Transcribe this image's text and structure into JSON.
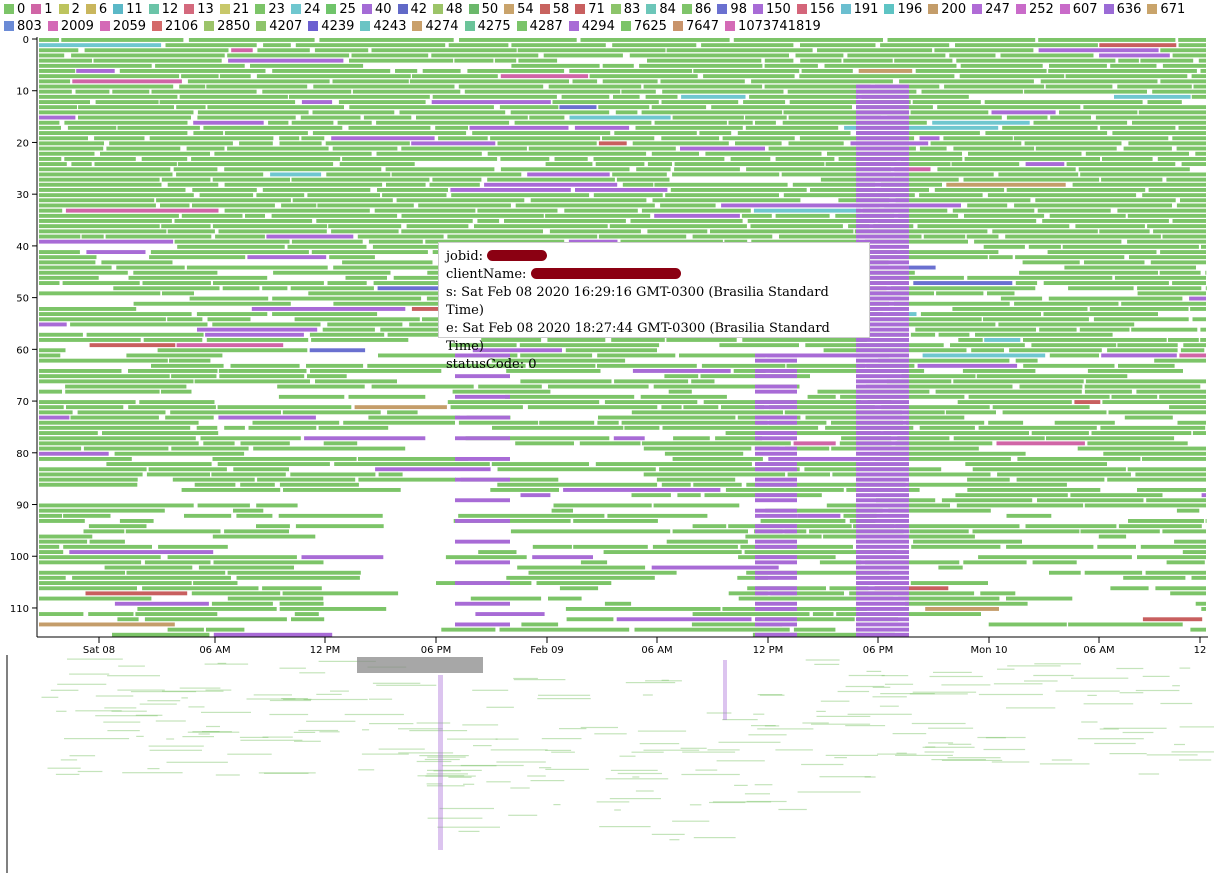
{
  "legend": [
    {
      "label": "0",
      "color": "#7cc468"
    },
    {
      "label": "1",
      "color": "#d065a6"
    },
    {
      "label": "2",
      "color": "#bdc45e"
    },
    {
      "label": "6",
      "color": "#c9b65d"
    },
    {
      "label": "11",
      "color": "#5bb8c7"
    },
    {
      "label": "12",
      "color": "#6bc4a8"
    },
    {
      "label": "13",
      "color": "#d4697d"
    },
    {
      "label": "21",
      "color": "#c8c86a"
    },
    {
      "label": "23",
      "color": "#7cc468"
    },
    {
      "label": "24",
      "color": "#6fc7cf"
    },
    {
      "label": "25",
      "color": "#6fc46a"
    },
    {
      "label": "40",
      "color": "#a46bd6"
    },
    {
      "label": "42",
      "color": "#6169c7"
    },
    {
      "label": "48",
      "color": "#9cc468"
    },
    {
      "label": "50",
      "color": "#6bb86b"
    },
    {
      "label": "54",
      "color": "#c9a36b"
    },
    {
      "label": "58",
      "color": "#c8635f"
    },
    {
      "label": "71",
      "color": "#c85f5f"
    },
    {
      "label": "83",
      "color": "#8cc46a"
    },
    {
      "label": "84",
      "color": "#6cc6b9"
    },
    {
      "label": "86",
      "color": "#7fc46a"
    },
    {
      "label": "98",
      "color": "#6a70d0"
    },
    {
      "label": "150",
      "color": "#a86bd6"
    },
    {
      "label": "156",
      "color": "#d4657a"
    },
    {
      "label": "191",
      "color": "#6bbfd0"
    },
    {
      "label": "196",
      "color": "#5ec4c4"
    },
    {
      "label": "200",
      "color": "#c49d6a"
    },
    {
      "label": "247",
      "color": "#b06bd6"
    },
    {
      "label": "252",
      "color": "#c96bc9"
    },
    {
      "label": "607",
      "color": "#c96bc9"
    },
    {
      "label": "636",
      "color": "#9b6bd6"
    },
    {
      "label": "671",
      "color": "#c9a46b"
    },
    {
      "label": "803",
      "color": "#6b8bd6"
    },
    {
      "label": "2009",
      "color": "#d46ab6"
    },
    {
      "label": "2059",
      "color": "#d46ab6"
    },
    {
      "label": "2106",
      "color": "#d46a6a"
    },
    {
      "label": "2850",
      "color": "#9cc46a"
    },
    {
      "label": "4207",
      "color": "#8ec46a"
    },
    {
      "label": "4239",
      "color": "#6b5fd0"
    },
    {
      "label": "4243",
      "color": "#6bc4c4"
    },
    {
      "label": "4274",
      "color": "#c9a06b"
    },
    {
      "label": "4275",
      "color": "#6bc49a"
    },
    {
      "label": "4287",
      "color": "#7bc46a"
    },
    {
      "label": "4294",
      "color": "#a86bd6"
    },
    {
      "label": "7625",
      "color": "#7cc468"
    },
    {
      "label": "7647",
      "color": "#c9946b"
    },
    {
      "label": "1073741819",
      "color": "#d46ab6"
    }
  ],
  "chart_data": {
    "type": "timeline",
    "y_ticks": [
      0,
      10,
      20,
      30,
      40,
      50,
      60,
      70,
      80,
      90,
      100,
      110
    ],
    "ylim": [
      0,
      116
    ],
    "x_ticks": [
      "Sat 08",
      "06 AM",
      "12 PM",
      "06 PM",
      "Feb 09",
      "06 AM",
      "12 PM",
      "06 PM",
      "Mon 10",
      "06 AM",
      "12"
    ],
    "series_colors": {
      "0": "#7cc468",
      "150": "#a86bd6",
      "1": "#d065a6",
      "24": "#6fc7cf",
      "98": "#6a70d0",
      "200": "#c49d6a",
      "71": "#c85f5f"
    }
  },
  "tooltip": {
    "jobid_label": "jobid:",
    "client_label": "clientName:",
    "start": "s: Sat Feb 08 2020 16:29:16 GMT-0300 (Brasilia Standard Time)",
    "end": "e: Sat Feb 08 2020 18:27:44 GMT-0300 (Brasilia Standard Time)",
    "status": "statusCode: 0"
  }
}
